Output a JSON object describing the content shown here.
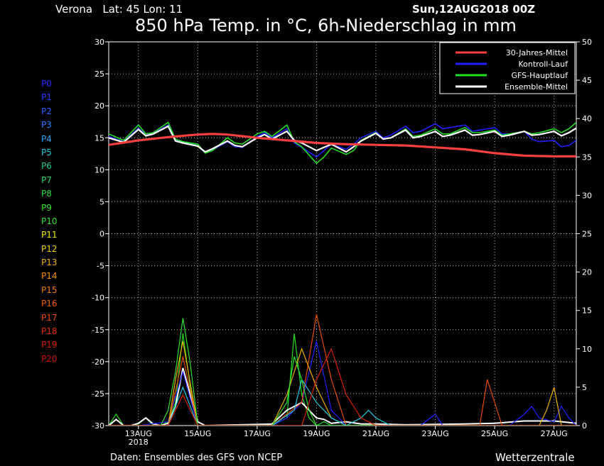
{
  "header": {
    "location": "Verona   Lat: 45 Lon: 11",
    "date": "Sun,12AUG2018 00Z",
    "title": "850 hPa Temp. in °C, 6h-Niederschlag in mm"
  },
  "footer": {
    "source": "Daten: Ensembles des GFS von NCEP",
    "brand": "Wetterzentrale"
  },
  "members": [
    {
      "label": "P0",
      "color": "#2a2aff"
    },
    {
      "label": "P1",
      "color": "#2a3cff"
    },
    {
      "label": "P2",
      "color": "#2a5cff"
    },
    {
      "label": "P3",
      "color": "#2a7cff"
    },
    {
      "label": "P4",
      "color": "#22aaff"
    },
    {
      "label": "P5",
      "color": "#22c8e0"
    },
    {
      "label": "P6",
      "color": "#22d090"
    },
    {
      "label": "P7",
      "color": "#22d860"
    },
    {
      "label": "P8",
      "color": "#28e040"
    },
    {
      "label": "P9",
      "color": "#40e830"
    },
    {
      "label": "P10",
      "color": "#30e030"
    },
    {
      "label": "P11",
      "color": "#f0f000"
    },
    {
      "label": "P12",
      "color": "#f0d000"
    },
    {
      "label": "P13",
      "color": "#f0b000"
    },
    {
      "label": "P14",
      "color": "#f09000"
    },
    {
      "label": "P15",
      "color": "#f07800"
    },
    {
      "label": "P16",
      "color": "#f06000"
    },
    {
      "label": "P17",
      "color": "#e84a00"
    },
    {
      "label": "P18",
      "color": "#e03000"
    },
    {
      "label": "P19",
      "color": "#d82000"
    },
    {
      "label": "P20",
      "color": "#d01000"
    }
  ],
  "chart_data": {
    "type": "line",
    "title": "850 hPa Temp. in °C, 6h-Niederschlag in mm",
    "left_axis": {
      "label": "",
      "range": [
        -30,
        30
      ],
      "ticks": [
        30,
        25,
        20,
        15,
        10,
        5,
        0,
        -5,
        -10,
        -15,
        -20,
        -25,
        -30
      ]
    },
    "right_axis": {
      "label": "",
      "range": [
        0,
        50
      ],
      "ticks": [
        50,
        45,
        40,
        35,
        30,
        25,
        20,
        15,
        10,
        5,
        0
      ]
    },
    "x_ticks": [
      {
        "day": 13,
        "label": "13AUG",
        "sublabel": "2018"
      },
      {
        "day": 15,
        "label": "15AUG",
        "sublabel": ""
      },
      {
        "day": 17,
        "label": "17AUG",
        "sublabel": ""
      },
      {
        "day": 19,
        "label": "19AUG",
        "sublabel": ""
      },
      {
        "day": 21,
        "label": "21AUG",
        "sublabel": ""
      },
      {
        "day": 23,
        "label": "23AUG",
        "sublabel": ""
      },
      {
        "day": 25,
        "label": "25AUG",
        "sublabel": ""
      },
      {
        "day": 27,
        "label": "27AUG",
        "sublabel": ""
      }
    ],
    "x_range_days": [
      12,
      27.75
    ],
    "grid": true,
    "legend": {
      "position": "top-right",
      "entries": [
        {
          "name": "30-Jahres-Mittel",
          "color": "#ff4040"
        },
        {
          "name": "Kontroll-Lauf",
          "color": "#2020ff"
        },
        {
          "name": "GFS-Hauptlauf",
          "color": "#20e020"
        },
        {
          "name": "Ensemble-Mittel",
          "color": "#ffffff"
        }
      ]
    },
    "series": [
      {
        "name": "30-Jahres-Mittel",
        "axis": "left",
        "color": "#ff4040",
        "x": [
          12.0,
          13.0,
          14.0,
          15.0,
          15.5,
          16.0,
          17.0,
          18.0,
          19.0,
          20.0,
          21.0,
          22.0,
          23.0,
          24.0,
          25.0,
          26.0,
          27.0,
          27.75
        ],
        "y": [
          13.9,
          14.6,
          15.1,
          15.5,
          15.6,
          15.5,
          15.0,
          14.6,
          14.2,
          14.0,
          13.9,
          13.8,
          13.5,
          13.2,
          12.6,
          12.2,
          12.1,
          12.1
        ]
      },
      {
        "name": "Ensemble-Mittel",
        "axis": "left",
        "color": "#ffffff",
        "x": [
          12.0,
          12.5,
          13.0,
          13.25,
          13.5,
          14.0,
          14.25,
          14.5,
          15.0,
          15.25,
          15.5,
          16.0,
          16.25,
          16.5,
          17.0,
          17.25,
          17.5,
          18.0,
          18.25,
          18.5,
          19.0,
          19.25,
          19.5,
          20.0,
          20.25,
          20.5,
          21.0,
          21.25,
          21.5,
          22.0,
          22.25,
          22.5,
          23.0,
          23.25,
          23.5,
          24.0,
          24.25,
          24.5,
          25.0,
          25.25,
          25.5,
          26.0,
          26.25,
          26.5,
          27.0,
          27.25,
          27.5,
          27.75
        ],
        "y": [
          15.0,
          14.3,
          16.3,
          15.3,
          15.6,
          16.8,
          14.5,
          14.2,
          13.7,
          12.8,
          13.3,
          14.5,
          13.8,
          13.6,
          15.0,
          15.5,
          14.8,
          16.0,
          14.6,
          14.2,
          13.0,
          13.5,
          14.0,
          12.8,
          13.6,
          14.5,
          15.7,
          14.8,
          15.0,
          16.2,
          15.0,
          15.2,
          16.0,
          15.2,
          15.4,
          16.2,
          15.4,
          15.5,
          16.0,
          15.2,
          15.4,
          16.0,
          15.4,
          15.5,
          16.0,
          15.3,
          15.8,
          16.5
        ]
      },
      {
        "name": "Kontroll-Lauf",
        "axis": "left",
        "color": "#2020ff",
        "x": [
          12.0,
          12.5,
          13.0,
          13.25,
          13.5,
          14.0,
          14.25,
          14.5,
          15.0,
          15.25,
          15.5,
          16.0,
          16.25,
          16.5,
          17.0,
          17.25,
          17.5,
          18.0,
          18.25,
          18.5,
          19.0,
          19.25,
          19.5,
          20.0,
          20.25,
          20.5,
          21.0,
          21.25,
          21.5,
          22.0,
          22.25,
          22.5,
          23.0,
          23.25,
          23.5,
          24.0,
          24.25,
          24.5,
          25.0,
          25.25,
          25.5,
          26.0,
          26.25,
          26.5,
          27.0,
          27.25,
          27.5,
          27.75
        ],
        "y": [
          15.2,
          14.4,
          16.5,
          15.5,
          15.7,
          17.0,
          14.6,
          14.3,
          13.8,
          12.6,
          13.1,
          14.4,
          13.6,
          13.5,
          15.2,
          15.8,
          15.0,
          16.4,
          14.2,
          13.5,
          12.0,
          13.0,
          14.0,
          13.2,
          14.0,
          15.0,
          16.0,
          15.0,
          15.4,
          16.8,
          15.8,
          16.0,
          17.2,
          16.4,
          16.6,
          17.0,
          16.0,
          16.2,
          16.6,
          15.6,
          15.6,
          16.0,
          14.8,
          14.4,
          14.6,
          13.6,
          13.8,
          14.6
        ]
      },
      {
        "name": "GFS-Hauptlauf",
        "axis": "left",
        "color": "#20e020",
        "x": [
          12.0,
          12.5,
          13.0,
          13.25,
          13.5,
          14.0,
          14.25,
          14.5,
          15.0,
          15.25,
          15.5,
          16.0,
          16.25,
          16.5,
          17.0,
          17.25,
          17.5,
          18.0,
          18.25,
          18.5,
          19.0,
          19.25,
          19.5,
          20.0,
          20.25,
          20.5,
          21.0,
          21.25,
          21.5,
          22.0,
          22.25,
          22.5,
          23.0,
          23.25,
          23.5,
          24.0,
          24.25,
          24.5,
          25.0,
          25.25,
          25.5,
          26.0,
          26.25,
          26.5,
          27.0,
          27.25,
          27.5,
          27.75
        ],
        "y": [
          15.6,
          14.6,
          17.0,
          15.6,
          15.8,
          17.4,
          14.8,
          14.4,
          14.0,
          12.6,
          13.0,
          15.0,
          14.2,
          14.0,
          15.6,
          16.0,
          15.2,
          17.0,
          14.4,
          13.6,
          11.0,
          12.0,
          13.4,
          12.4,
          13.0,
          14.6,
          15.8,
          14.8,
          15.0,
          16.4,
          15.2,
          15.4,
          16.4,
          15.6,
          15.6,
          16.6,
          15.8,
          15.8,
          16.2,
          15.4,
          15.6,
          16.0,
          15.6,
          15.8,
          16.4,
          15.8,
          16.4,
          17.4
        ]
      }
    ],
    "precip_series": [
      {
        "name": "GFS-Hauptlauf",
        "axis": "right",
        "color": "#20e020",
        "x": [
          12.0,
          12.25,
          12.5,
          12.75,
          13.0,
          13.25,
          13.5,
          13.75,
          14.0,
          14.25,
          14.5,
          14.75,
          15.0,
          15.25,
          17.5,
          18.0,
          18.25,
          18.5,
          18.75,
          19.0,
          19.25,
          19.5,
          20.0,
          27.75
        ],
        "y": [
          0,
          1.5,
          0,
          0,
          0.2,
          1.0,
          0,
          0,
          0.5,
          3.0,
          12.0,
          5.0,
          0,
          0,
          0,
          1.0,
          12.0,
          4.0,
          1.0,
          0,
          0.5,
          0,
          0,
          0
        ]
      },
      {
        "name": "Ensemble-Mittel",
        "axis": "right",
        "color": "#ffffff",
        "x": [
          12.0,
          12.25,
          12.5,
          12.75,
          13.0,
          13.25,
          13.5,
          13.75,
          14.0,
          14.25,
          14.5,
          14.75,
          15.0,
          15.25,
          17.5,
          18.0,
          18.25,
          18.5,
          18.75,
          19.0,
          19.25,
          19.5,
          20.0,
          20.5,
          21.0,
          22.0,
          24.0,
          25.0,
          26.0,
          27.0,
          27.75
        ],
        "y": [
          0,
          0.8,
          0,
          0,
          0.3,
          1.0,
          0.2,
          0,
          0.3,
          2.5,
          7.5,
          4.0,
          0.5,
          0,
          0.2,
          2.0,
          2.5,
          3.0,
          2.0,
          1.0,
          0.8,
          0.3,
          0.5,
          0.2,
          0.2,
          0.1,
          0.2,
          0.3,
          0.6,
          0.6,
          0.3
        ]
      },
      {
        "name": "Kontroll-Lauf",
        "axis": "right",
        "color": "#2020ff",
        "x": [
          12.0,
          13.0,
          14.0,
          14.5,
          15.0,
          17.5,
          18.0,
          18.5,
          19.0,
          19.5,
          20.0,
          22.5,
          23.0,
          23.25,
          23.5,
          25.5,
          26.0,
          26.25,
          26.5,
          27.0,
          27.25,
          27.5,
          27.75
        ],
        "y": [
          0,
          0,
          0.5,
          7.0,
          0,
          0,
          1.0,
          3.0,
          11.0,
          2.0,
          0,
          0,
          1.5,
          0,
          0,
          0,
          1.5,
          2.5,
          1.0,
          0.5,
          2.5,
          1.0,
          0
        ]
      },
      {
        "name": "P17",
        "axis": "right",
        "color": "#e84a00",
        "x": [
          12.0,
          14.0,
          14.5,
          15.0,
          17.5,
          18.5,
          19.0,
          19.5,
          20.0,
          24.5,
          24.75,
          25.0,
          25.25,
          27.75
        ],
        "y": [
          0,
          0,
          9.0,
          0,
          0,
          3.0,
          14.5,
          6.0,
          0,
          0,
          6.0,
          3.0,
          0,
          0
        ]
      },
      {
        "name": "P13",
        "axis": "right",
        "color": "#f0b000",
        "x": [
          12.0,
          14.0,
          14.25,
          14.5,
          15.0,
          17.5,
          18.0,
          18.5,
          19.0,
          19.5,
          20.0,
          26.5,
          26.75,
          27.0,
          27.25,
          27.75
        ],
        "y": [
          0,
          0,
          6.0,
          11.0,
          0,
          0,
          4.0,
          10.0,
          5.0,
          1.0,
          0,
          0,
          2.0,
          5.0,
          0,
          0
        ]
      },
      {
        "name": "P5",
        "axis": "right",
        "color": "#22c8e0",
        "x": [
          12.0,
          14.0,
          14.5,
          15.0,
          17.5,
          18.25,
          18.5,
          19.0,
          19.5,
          20.0,
          20.5,
          20.75,
          21.0,
          21.5,
          27.75
        ],
        "y": [
          0,
          0,
          5.0,
          0,
          0,
          2.0,
          6.0,
          3.0,
          1.0,
          0,
          1.0,
          2.0,
          1.0,
          0,
          0
        ]
      },
      {
        "name": "P10",
        "axis": "right",
        "color": "#30e030",
        "x": [
          12.0,
          13.75,
          14.0,
          14.25,
          14.5,
          14.75,
          15.0,
          17.5,
          18.0,
          18.25,
          18.5,
          18.75,
          19.0,
          27.75
        ],
        "y": [
          0,
          0,
          2.0,
          7.0,
          14.0,
          8.0,
          0,
          0,
          3.0,
          9.0,
          6.0,
          2.0,
          0,
          0
        ]
      },
      {
        "name": "P19",
        "axis": "right",
        "color": "#d82000",
        "x": [
          12.0,
          14.0,
          14.5,
          15.0,
          18.5,
          19.0,
          19.5,
          20.0,
          20.5,
          21.0,
          27.75
        ],
        "y": [
          0,
          0,
          4.0,
          0,
          0,
          6.0,
          10.0,
          4.0,
          1.0,
          0,
          0
        ]
      }
    ]
  }
}
